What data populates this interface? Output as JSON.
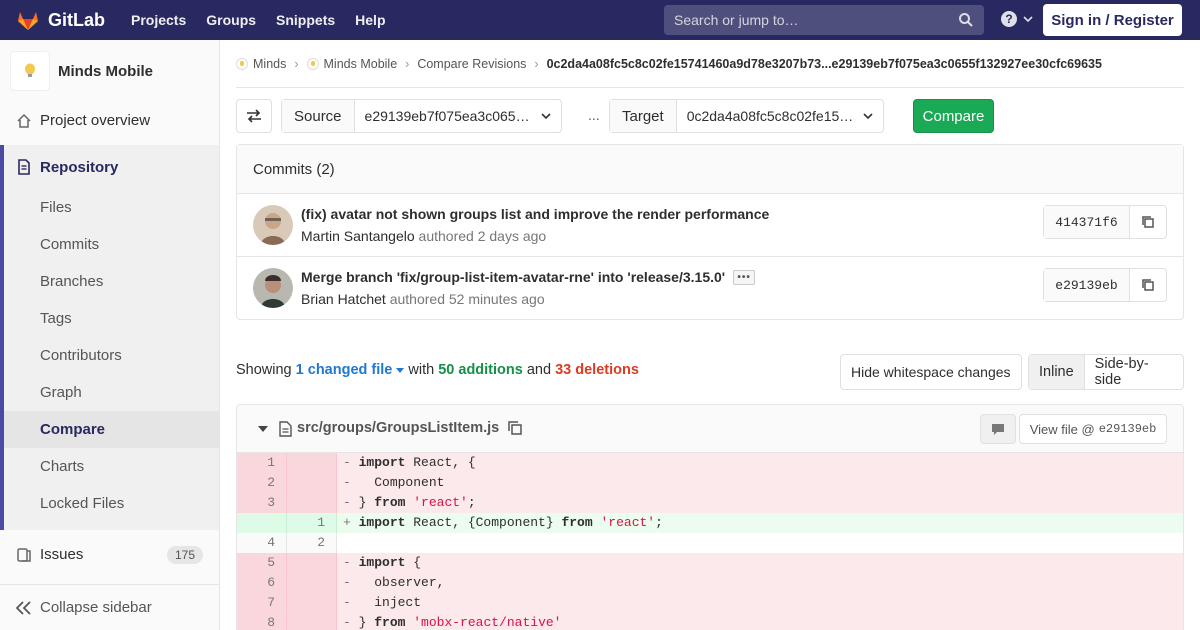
{
  "topnav": {
    "brand": "GitLab",
    "links": [
      "Projects",
      "Groups",
      "Snippets",
      "Help"
    ],
    "search_placeholder": "Search or jump to…",
    "signin": "Sign in / Register"
  },
  "sidebar": {
    "project_name": "Minds Mobile",
    "overview": "Project overview",
    "repository": "Repository",
    "repo_items": [
      "Files",
      "Commits",
      "Branches",
      "Tags",
      "Contributors",
      "Graph",
      "Compare",
      "Charts",
      "Locked Files"
    ],
    "active_item": "Compare",
    "issues": "Issues",
    "issues_count": "175",
    "collapse": "Collapse sidebar"
  },
  "breadcrumbs": [
    "Minds",
    "Minds Mobile",
    "Compare Revisions",
    "0c2da4a08fc5c8c02fe15741460a9d78e3207b73...e29139eb7f075ea3c0655f132927ee30cfc69635"
  ],
  "compare": {
    "source_label": "Source",
    "source_value": "e29139eb7f075ea3c0655f132927ee30cfc69635",
    "ellipsis": "...",
    "target_label": "Target",
    "target_value": "0c2da4a08fc5c8c02fe15741460a9d78e3207b73",
    "button": "Compare"
  },
  "commits": {
    "header": "Commits (2)",
    "items": [
      {
        "title": "(fix) avatar not shown groups list and improve the render performance",
        "author": "Martin Santangelo",
        "authored": "authored 2 days ago",
        "sha": "414371f6",
        "has_more": false
      },
      {
        "title": "Merge branch 'fix/group-list-item-avatar-rne' into 'release/3.15.0'",
        "author": "Brian Hatchet",
        "authored": "authored 52 minutes ago",
        "sha": "e29139eb",
        "has_more": true
      }
    ]
  },
  "summary": {
    "showing": "Showing",
    "changed": "1 changed file",
    "with": "with",
    "additions": "50 additions",
    "and": "and",
    "deletions": "33 deletions",
    "whitespace_btn": "Hide whitespace changes",
    "inline": "Inline",
    "side_by_side": "Side-by-side"
  },
  "file": {
    "path": "src/groups/GroupsListItem.js",
    "view_file": "View file @",
    "view_sha": "e29139eb",
    "lines": [
      {
        "type": "del",
        "old": "1",
        "new": "",
        "sign": "-",
        "code": [
          {
            "t": "kw",
            "v": "import"
          },
          {
            "t": "",
            "v": " React, {"
          }
        ]
      },
      {
        "type": "del",
        "old": "2",
        "new": "",
        "sign": "-",
        "code": [
          {
            "t": "",
            "v": "  Component"
          }
        ]
      },
      {
        "type": "del",
        "old": "3",
        "new": "",
        "sign": "-",
        "code": [
          {
            "t": "",
            "v": "} "
          },
          {
            "t": "kw",
            "v": "from"
          },
          {
            "t": "",
            "v": " "
          },
          {
            "t": "str",
            "v": "'react'"
          },
          {
            "t": "",
            "v": ";"
          }
        ]
      },
      {
        "type": "add",
        "old": "",
        "new": "1",
        "sign": "+",
        "code": [
          {
            "t": "kw",
            "v": "import"
          },
          {
            "t": "",
            "v": " React, {Component} "
          },
          {
            "t": "kw",
            "v": "from"
          },
          {
            "t": "",
            "v": " "
          },
          {
            "t": "str",
            "v": "'react'"
          },
          {
            "t": "",
            "v": ";"
          }
        ]
      },
      {
        "type": "ctx",
        "old": "4",
        "new": "2",
        "sign": " ",
        "code": [
          {
            "t": "",
            "v": ""
          }
        ]
      },
      {
        "type": "del",
        "old": "5",
        "new": "",
        "sign": "-",
        "code": [
          {
            "t": "kw",
            "v": "import"
          },
          {
            "t": "",
            "v": " {"
          }
        ]
      },
      {
        "type": "del",
        "old": "6",
        "new": "",
        "sign": "-",
        "code": [
          {
            "t": "",
            "v": "  observer,"
          }
        ]
      },
      {
        "type": "del",
        "old": "7",
        "new": "",
        "sign": "-",
        "code": [
          {
            "t": "",
            "v": "  inject"
          }
        ]
      },
      {
        "type": "del",
        "old": "8",
        "new": "",
        "sign": "-",
        "code": [
          {
            "t": "",
            "v": "} "
          },
          {
            "t": "kw",
            "v": "from"
          },
          {
            "t": "",
            "v": " "
          },
          {
            "t": "str",
            "v": "'mobx-react/native'"
          }
        ]
      }
    ]
  },
  "colors": {
    "nav": "#292961",
    "accent": "#1aaa55",
    "link": "#1f78d1",
    "addition": "#168f48",
    "deletion": "#db3b21"
  }
}
